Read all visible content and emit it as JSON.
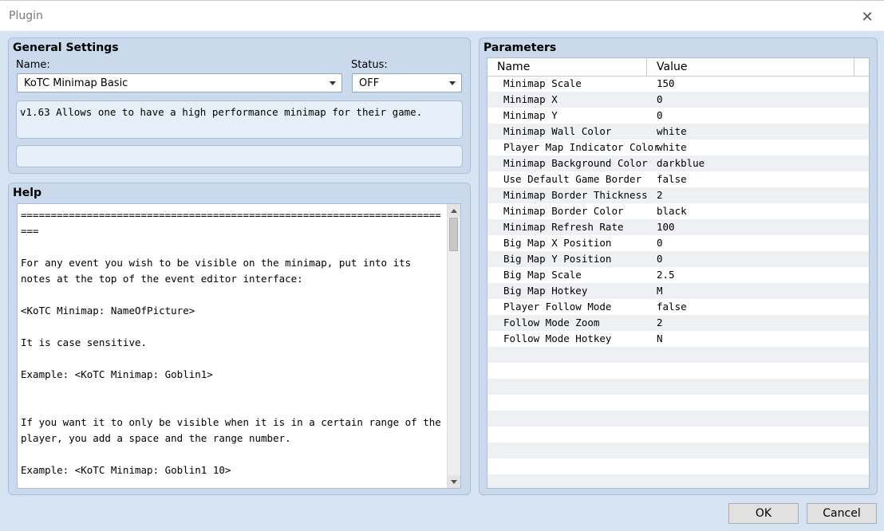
{
  "window": {
    "title": "Plugin",
    "close_icon": "close-icon"
  },
  "general": {
    "title": "General Settings",
    "name_label": "Name:",
    "name_value": "KoTC Minimap Basic",
    "status_label": "Status:",
    "status_value": "OFF",
    "description": "v1.63 Allows one to have a high performance minimap for their game.",
    "author": ""
  },
  "help": {
    "title": "Help",
    "text": "=========================================================================\n\nFor any event you wish to be visible on the minimap, put into its notes at the top of the event editor interface:\n\n<KoTC Minimap: NameOfPicture>\n\nIt is case sensitive.\n\nExample: <KoTC Minimap: Goblin1>\n\n\nIf you want it to only be visible when it is in a certain range of the player, you add a space and the range number.\n\nExample: <KoTC Minimap: Goblin1 10>\n\nWorks for page comments as well, exact same format."
  },
  "parameters": {
    "title": "Parameters",
    "col_name": "Name",
    "col_value": "Value",
    "rows": [
      {
        "name": "Minimap Scale",
        "value": "150"
      },
      {
        "name": "Minimap X",
        "value": "0"
      },
      {
        "name": "Minimap Y",
        "value": "0"
      },
      {
        "name": "Minimap Wall Color",
        "value": "white"
      },
      {
        "name": "Player Map Indicator Color",
        "value": "white"
      },
      {
        "name": "Minimap Background Color",
        "value": "darkblue"
      },
      {
        "name": "Use Default Game Border",
        "value": "false"
      },
      {
        "name": "Minimap Border Thickness",
        "value": "2"
      },
      {
        "name": "Minimap Border Color",
        "value": "black"
      },
      {
        "name": "Minimap Refresh Rate",
        "value": "100"
      },
      {
        "name": "Big Map X Position",
        "value": "0"
      },
      {
        "name": "Big Map Y Position",
        "value": "0"
      },
      {
        "name": "Big Map Scale",
        "value": "2.5"
      },
      {
        "name": "Big Map Hotkey",
        "value": "M"
      },
      {
        "name": "Player Follow Mode",
        "value": "false"
      },
      {
        "name": "Follow Mode Zoom",
        "value": "2"
      },
      {
        "name": "Follow Mode Hotkey",
        "value": "N"
      }
    ]
  },
  "buttons": {
    "ok": "OK",
    "cancel": "Cancel"
  }
}
